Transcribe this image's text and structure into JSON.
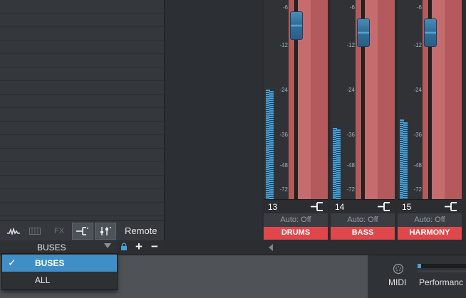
{
  "toolbar": {
    "remote_label": "Remote",
    "fx_label": "FX"
  },
  "selector": {
    "value": "BUSES"
  },
  "dropdown": {
    "check": "✓",
    "options": [
      {
        "label": "BUSES",
        "selected": true
      },
      {
        "label": "ALL",
        "selected": false
      }
    ]
  },
  "scale_labels": [
    "-6",
    "-12",
    "-24",
    "-36",
    "-48",
    "-72"
  ],
  "channels": [
    {
      "number": "13",
      "automation": "Auto: Off",
      "name": "DRUMS"
    },
    {
      "number": "14",
      "automation": "Auto: Off",
      "name": "BASS"
    },
    {
      "number": "15",
      "automation": "Auto: Off",
      "name": "HARMONY"
    }
  ],
  "status": {
    "midi_label": "MIDI",
    "performance_label": "Performanc",
    "performance_level": 0.08
  },
  "colors": {
    "channel_strip": "#b45a5c",
    "channel_name_bg": "#e0474a",
    "selection_blue": "#3f8ec6",
    "meter_blue": "#4aa0d6"
  },
  "icons": [
    "waveform-icon",
    "keyboard-icon",
    "routing-icon",
    "mixer-settings-icon",
    "lock-icon",
    "plus-icon",
    "minus-icon",
    "midi-port-icon",
    "scroll-left-icon"
  ]
}
